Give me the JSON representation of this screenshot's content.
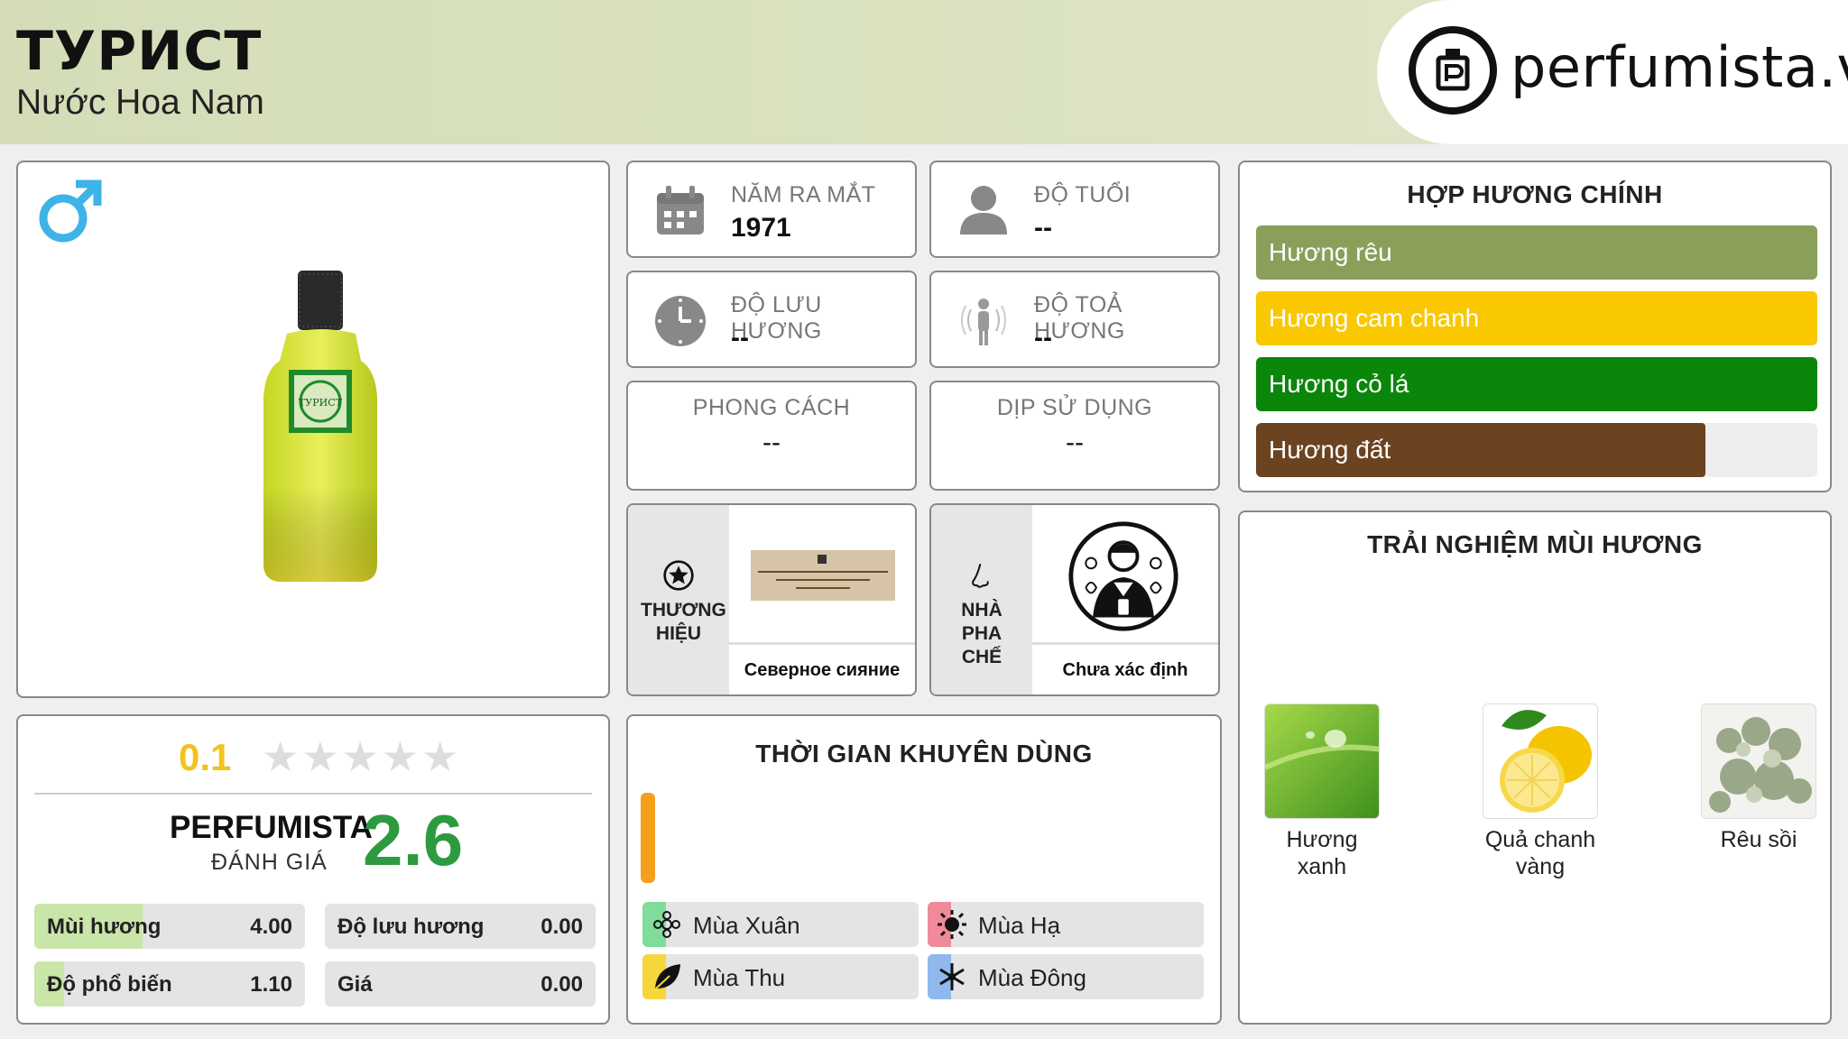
{
  "header": {
    "title": "ТУРИСТ",
    "subtitle": "Nước Hoa Nam",
    "logo_text": "perfumista.vn"
  },
  "info": {
    "launch_year": {
      "label": "NĂM RA MẮT",
      "value": "1971"
    },
    "age": {
      "label": "ĐỘ TUỔI",
      "value": "--"
    },
    "longevity": {
      "label": "ĐỘ LƯU HƯƠNG",
      "value": "--"
    },
    "sillage": {
      "label": "ĐỘ TOẢ HƯƠNG",
      "value": "--"
    },
    "style": {
      "label": "PHONG CÁCH",
      "value": "--"
    },
    "occasion": {
      "label": "DỊP SỬ DỤNG",
      "value": "--"
    },
    "brand": {
      "label": "THƯƠNG HIỆU",
      "name": "Северное сияние"
    },
    "perfumer": {
      "label": "NHÀ PHA CHẾ",
      "name": "Chưa xác định"
    }
  },
  "accords": {
    "title": "HỢP HƯƠNG CHÍNH",
    "items": [
      {
        "label": "Hương rêu",
        "color": "#8aa05a",
        "fill": 1.0
      },
      {
        "label": "Hương cam chanh",
        "color": "#f9c800",
        "fill": 1.0
      },
      {
        "label": "Hương cỏ lá",
        "color": "#0a860a",
        "fill": 1.0
      },
      {
        "label": "Hương đất",
        "color": "#6b4321",
        "fill": 0.8
      }
    ]
  },
  "rating": {
    "user_score": "0.1",
    "stars_filled": 0.02,
    "perfumista_label": "PERFUMISTA",
    "perfumista_sub": "ĐÁNH GIÁ",
    "perfumista_score": "2.6",
    "metrics": [
      {
        "label": "Mùi hương",
        "value": "4.00",
        "fill": 0.4
      },
      {
        "label": "Độ lưu hương",
        "value": "0.00",
        "fill": 0
      },
      {
        "label": "Độ phổ biến",
        "value": "1.10",
        "fill": 0.11
      },
      {
        "label": "Giá",
        "value": "0.00",
        "fill": 0
      }
    ]
  },
  "time": {
    "title": "THỜI GIAN KHUYÊN DÙNG",
    "seasons": [
      {
        "label": "Mùa Xuân",
        "color": "#7fdc9a",
        "icon": "flower-icon"
      },
      {
        "label": "Mùa Hạ",
        "color": "#f08a9a",
        "icon": "sun-icon"
      },
      {
        "label": "Mùa Thu",
        "color": "#f6d63a",
        "icon": "leaf-icon"
      },
      {
        "label": "Mùa Đông",
        "color": "#8fb8ee",
        "icon": "snowflake-icon"
      }
    ]
  },
  "notes": {
    "title": "TRẢI NGHIỆM MÙI HƯƠNG",
    "items": [
      {
        "label": "Hương xanh",
        "icon": "green-leaf-drop-image"
      },
      {
        "label": "Quả chanh vàng",
        "icon": "lemon-image"
      },
      {
        "label": "Rêu sồi",
        "icon": "oakmoss-image"
      }
    ]
  }
}
